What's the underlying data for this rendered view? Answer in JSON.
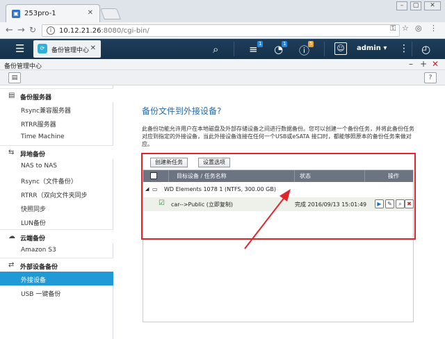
{
  "browser": {
    "tab_title": "253pro-1",
    "tab_favicon": "qnap-favicon",
    "url_host": "10.12.21.26",
    "url_path": ":8080/cgi-bin/"
  },
  "header": {
    "app_tab_label": "备份管理中心",
    "badge_tasks": "1",
    "badge_notifications": "1",
    "badge_info": "5",
    "user": "admin ▾"
  },
  "app": {
    "title": "备份管理中心"
  },
  "sidebar": {
    "groups": [
      {
        "label": "备份服务器",
        "items": [
          "Rsync兼容服务器",
          "RTRR服务器",
          "Time Machine"
        ]
      },
      {
        "label": "异地备份",
        "items": [
          "NAS to NAS",
          "Rsync（文件备份）",
          "RTRR（双向文件夹同步",
          "快照同步",
          "LUN备份"
        ]
      },
      {
        "label": "云端备份",
        "items": [
          "Amazon S3"
        ]
      },
      {
        "label": "外部设备备份",
        "items": [
          "外接设备",
          "USB 一键备份"
        ]
      }
    ]
  },
  "main": {
    "title": "备份文件到外接设备?",
    "description": "此备份功能允许用户在本地磁盘及外部存储设备之间进行数据备份。您可以创建一个备份任务，并将此备份任务对应到指定的外接设备，当此外接设备连接在任何一个USB或eSATA 接口时，都能够照原本的备份任务来做对应。",
    "buttons": {
      "create": "创建新任务",
      "options": "设置选项"
    },
    "columns": {
      "target": "目标设备 / 任务名称",
      "status": "状态",
      "action": "操作"
    },
    "device": "WD Elements 1078  1 (NTFS, 300.00 GB)",
    "job": {
      "name": "car-->Public (立即复制)",
      "status": "完成 2016/09/13 15:01:49"
    }
  },
  "colors": {
    "accent": "#1f9ad6",
    "header": "#1f3e5a",
    "highlight": "#e0262a"
  }
}
